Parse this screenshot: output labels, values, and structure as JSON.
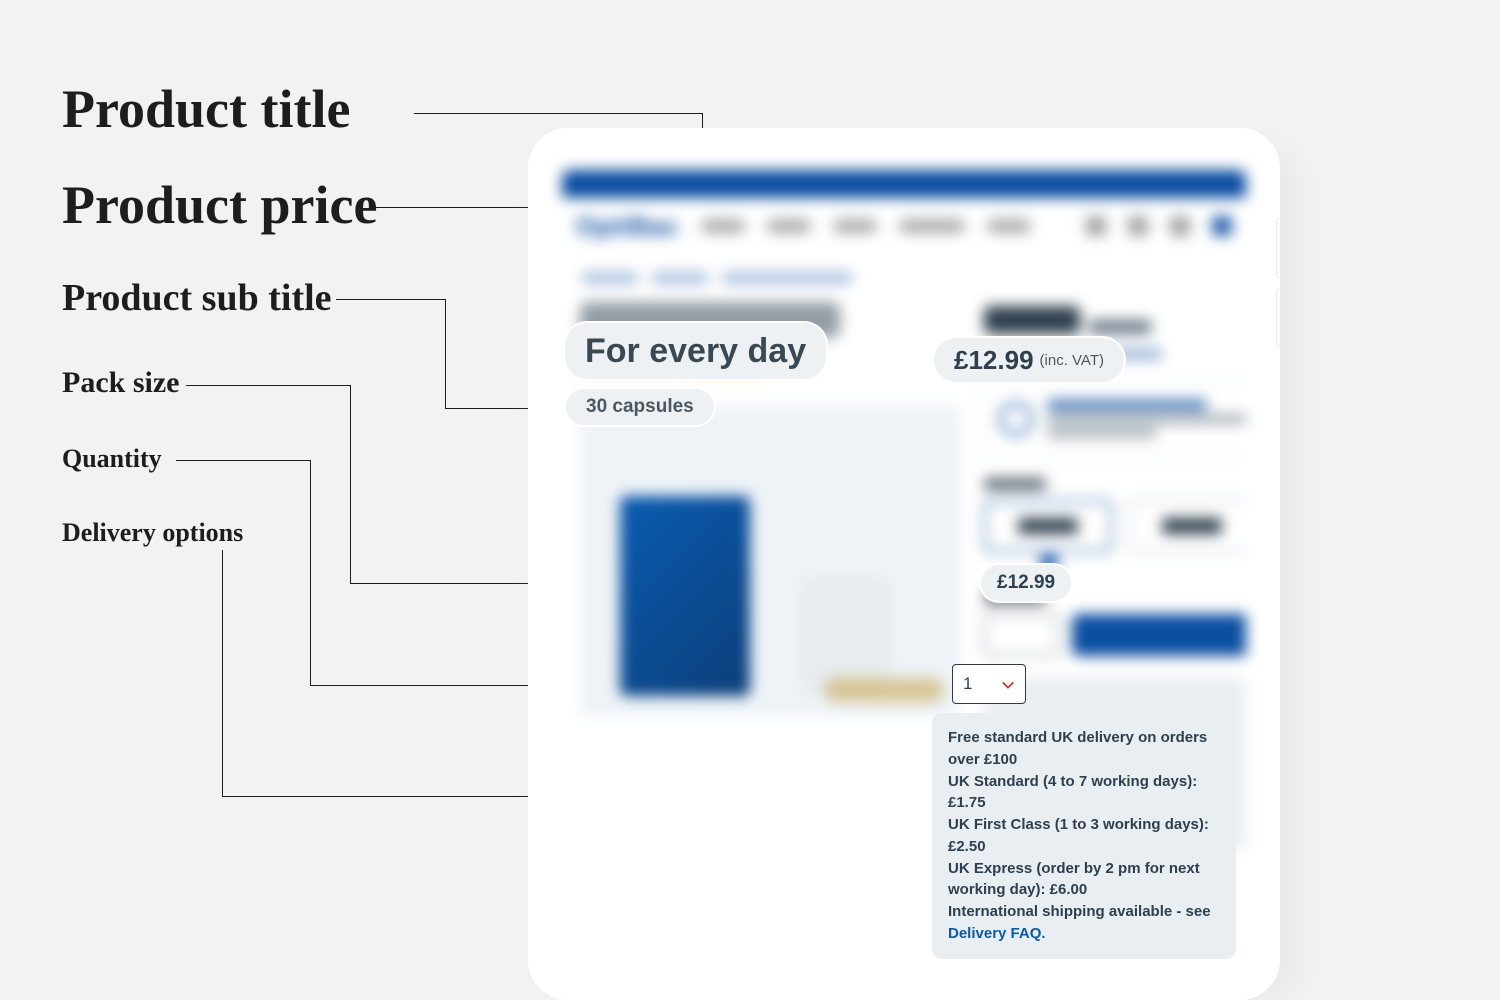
{
  "annotations": {
    "title": "Product title",
    "price": "Product price",
    "subtitle": "Product sub title",
    "pack": "Pack size",
    "qty": "Quantity",
    "delivery": "Delivery options"
  },
  "product": {
    "title": "For every day",
    "subtitle": "30 capsules",
    "price": "£12.99",
    "price_note": "(inc. VAT)",
    "pack_price_selected": "£12.99",
    "quantity": "1"
  },
  "delivery": {
    "l1": "Free standard UK delivery on orders over £100",
    "l2": "UK Standard (4 to 7 working days): £1.75",
    "l3": "UK First Class (1 to 3 working days): £2.50",
    "l4": "UK Express (order by 2 pm for next working day): £6.00",
    "l5a": "International shipping available - see ",
    "l5b": "Delivery FAQ."
  }
}
